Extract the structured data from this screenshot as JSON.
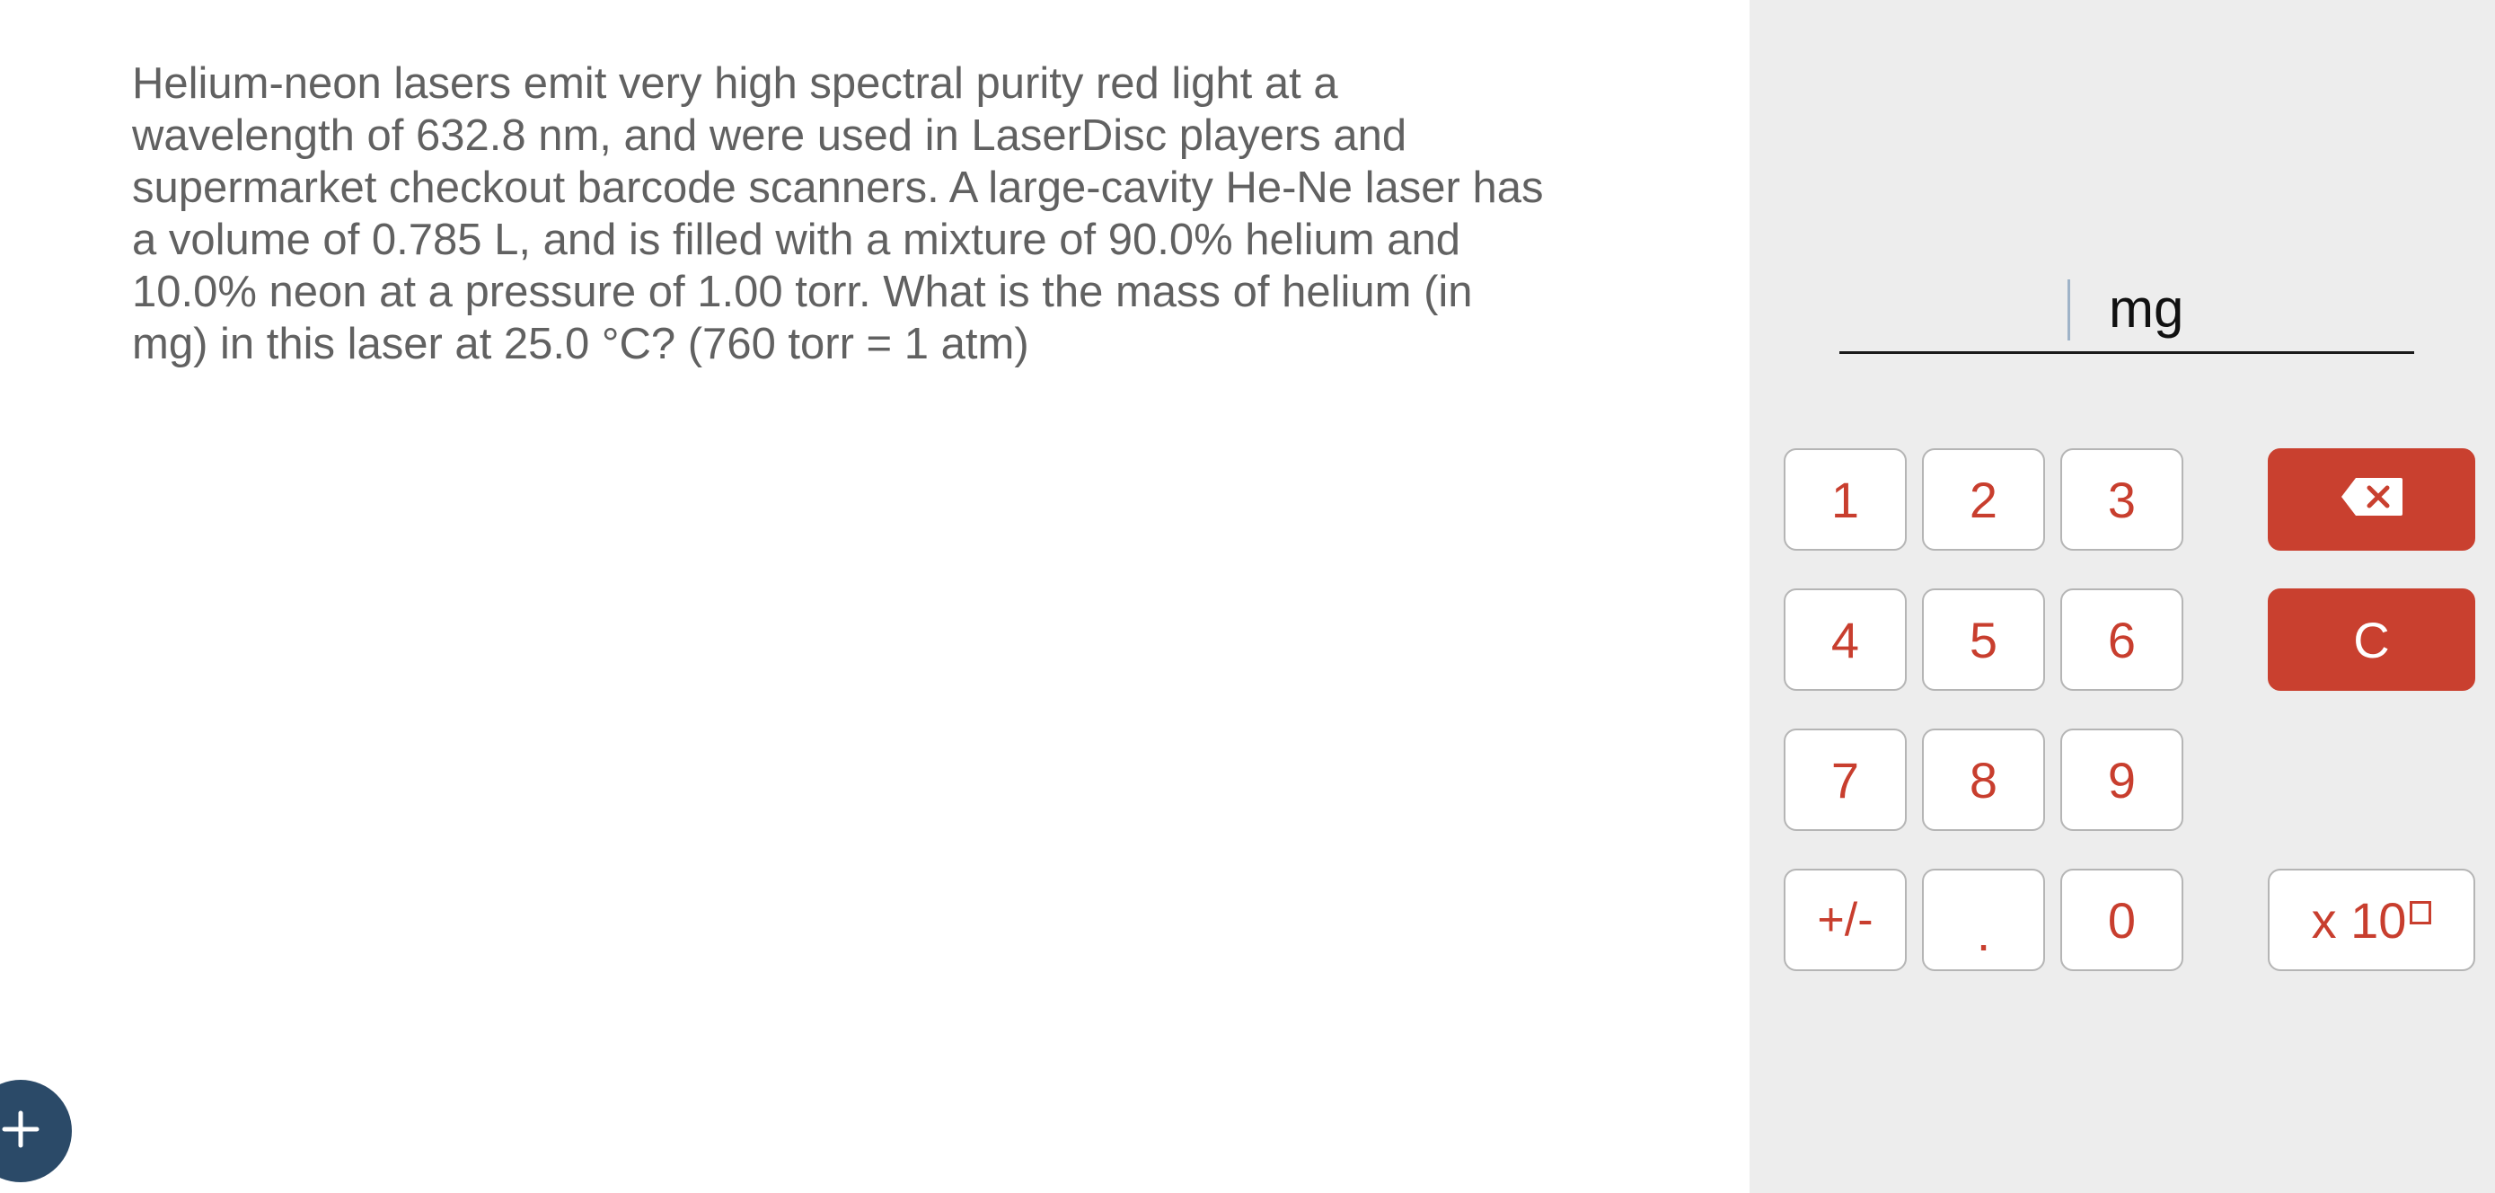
{
  "question": {
    "text": "Helium-neon lasers emit very high spectral purity red light at a wavelength of 632.8 nm, and were used in LaserDisc players and supermarket checkout barcode scanners. A large-cavity He-Ne laser has a volume of 0.785 L, and is filled with a mixture of 90.0% helium and 10.0% neon at a pressure of 1.00 torr. What is the mass of helium (in mg) in this laser at 25.0 °C? (760 torr = 1 atm)"
  },
  "answer": {
    "value": "",
    "unit": "mg"
  },
  "keypad": {
    "k1": "1",
    "k2": "2",
    "k3": "3",
    "k4": "4",
    "k5": "5",
    "k6": "6",
    "k7": "7",
    "k8": "8",
    "k9": "9",
    "sign": "+/-",
    "dot": ".",
    "k0": "0",
    "clear": "C",
    "sci": "x 10",
    "backspace_icon": "backspace-icon"
  },
  "fab": {
    "icon": "plus-icon"
  },
  "colors": {
    "accent_red": "#c9402f",
    "key_text": "#c83e2e",
    "panel_bg": "#ededed",
    "fab_bg": "#2b4a68",
    "question_text": "#616161"
  }
}
